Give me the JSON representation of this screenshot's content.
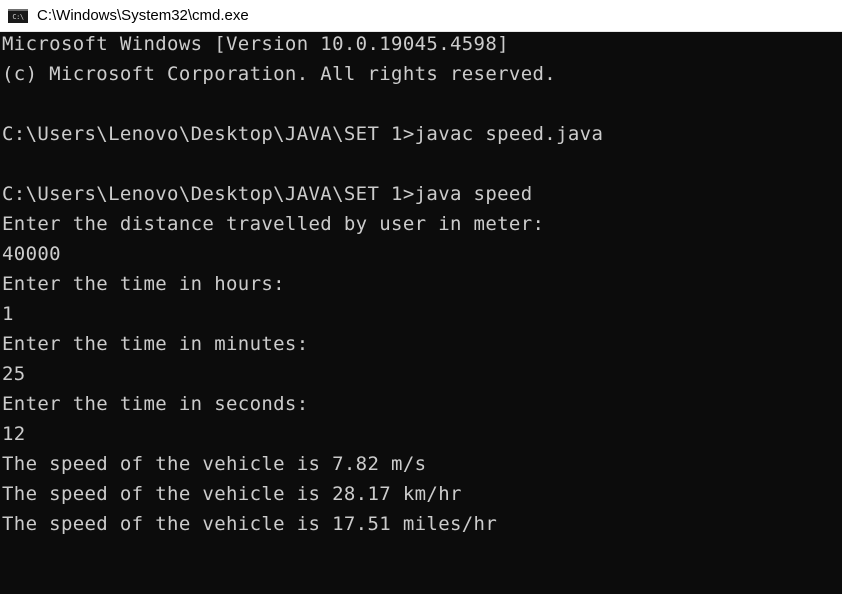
{
  "window": {
    "title": "C:\\Windows\\System32\\cmd.exe",
    "icon": "cmd-icon",
    "icon_text": "C:\\"
  },
  "console": {
    "lines": [
      "Microsoft Windows [Version 10.0.19045.4598]",
      "(c) Microsoft Corporation. All rights reserved.",
      "",
      "C:\\Users\\Lenovo\\Desktop\\JAVA\\SET 1>javac speed.java",
      "",
      "C:\\Users\\Lenovo\\Desktop\\JAVA\\SET 1>java speed",
      "Enter the distance travelled by user in meter:",
      "40000",
      "Enter the time in hours:",
      "1",
      "Enter the time in minutes:",
      "25",
      "Enter the time in seconds:",
      "12",
      "The speed of the vehicle is 7.82 m/s",
      "The speed of the vehicle is 28.17 km/hr",
      "The speed of the vehicle is 17.51 miles/hr"
    ]
  },
  "colors": {
    "background": "#0c0c0c",
    "text": "#cccccc",
    "titlebar": "#ffffff"
  }
}
